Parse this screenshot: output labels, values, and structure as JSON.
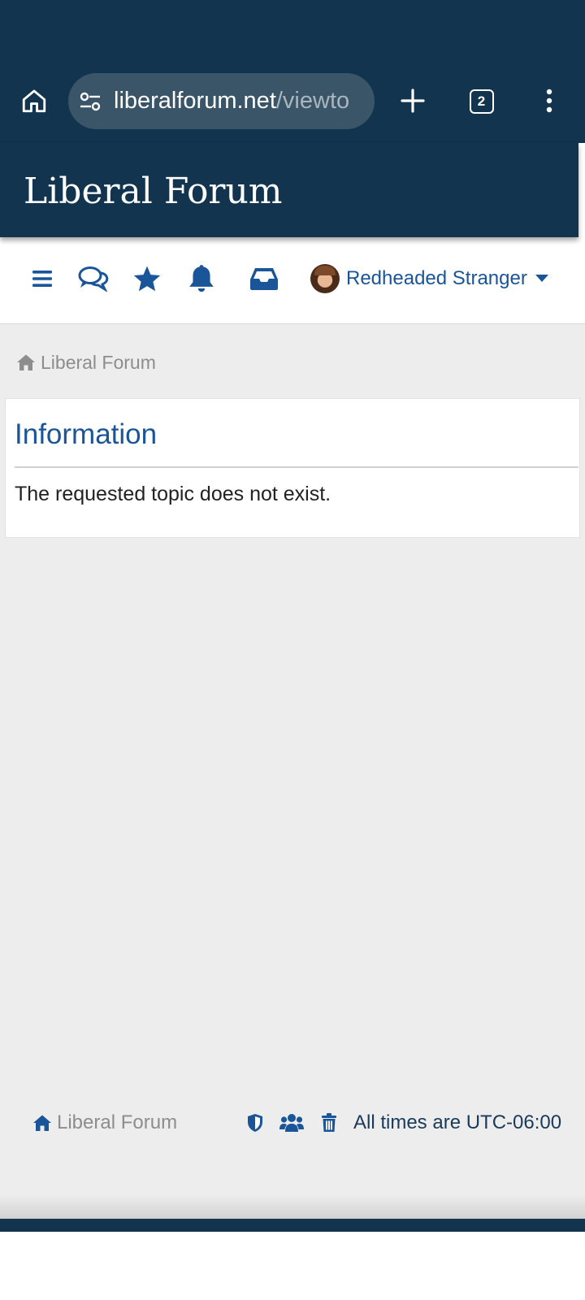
{
  "browser": {
    "url_host": "liberalforum.net",
    "url_path": "/viewto",
    "tab_count": "2"
  },
  "header": {
    "site_title": "Liberal Forum"
  },
  "nav": {
    "user_name": "Redheaded Stranger"
  },
  "breadcrumb": {
    "home_label": "Liberal Forum"
  },
  "info": {
    "title": "Information",
    "message": "The requested topic does not exist."
  },
  "footer": {
    "home_label": "Liberal Forum",
    "timezone": "All times are UTC-06:00"
  },
  "colors": {
    "header_bg": "#12344f",
    "accent": "#1a5599",
    "page_bg": "#ededed"
  }
}
